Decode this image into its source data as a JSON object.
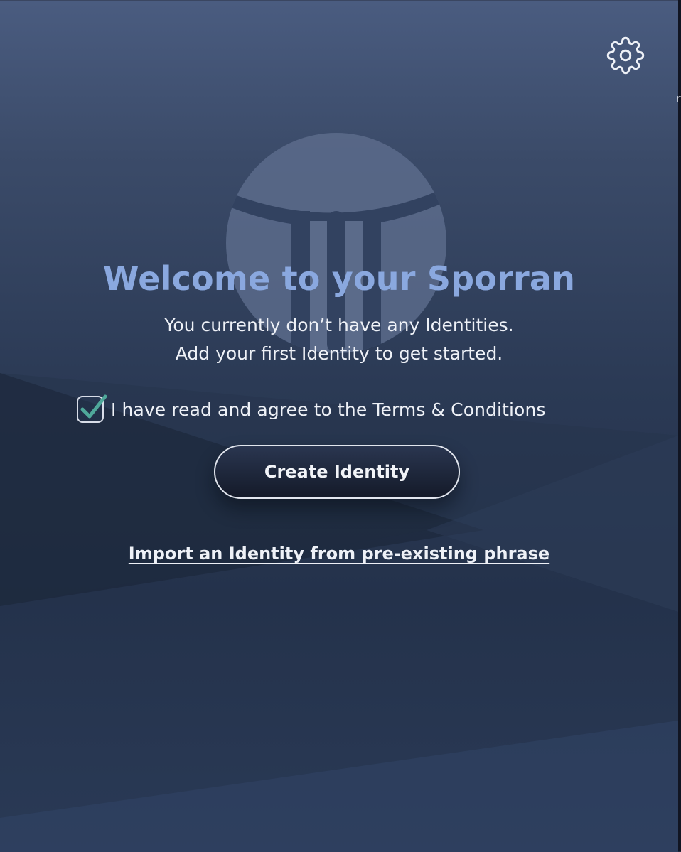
{
  "welcome": {
    "title": "Welcome to your Sporran",
    "subtitle_line1": "You currently don’t have any Identities.",
    "subtitle_line2": "Add your first Identity to get started."
  },
  "terms": {
    "checked": true,
    "label": "I have read and agree to the Terms & Conditions"
  },
  "actions": {
    "create_label": "Create Identity",
    "import_label": "Import an Identity from pre-existing phrase"
  },
  "icons": {
    "settings": "gear-icon",
    "logo": "sporran-logo",
    "check": "checkmark-icon"
  },
  "colors": {
    "title": "#8aa8df",
    "check_accent": "#4fa89a",
    "text": "#eef1f7"
  },
  "edge_glyph": "r"
}
